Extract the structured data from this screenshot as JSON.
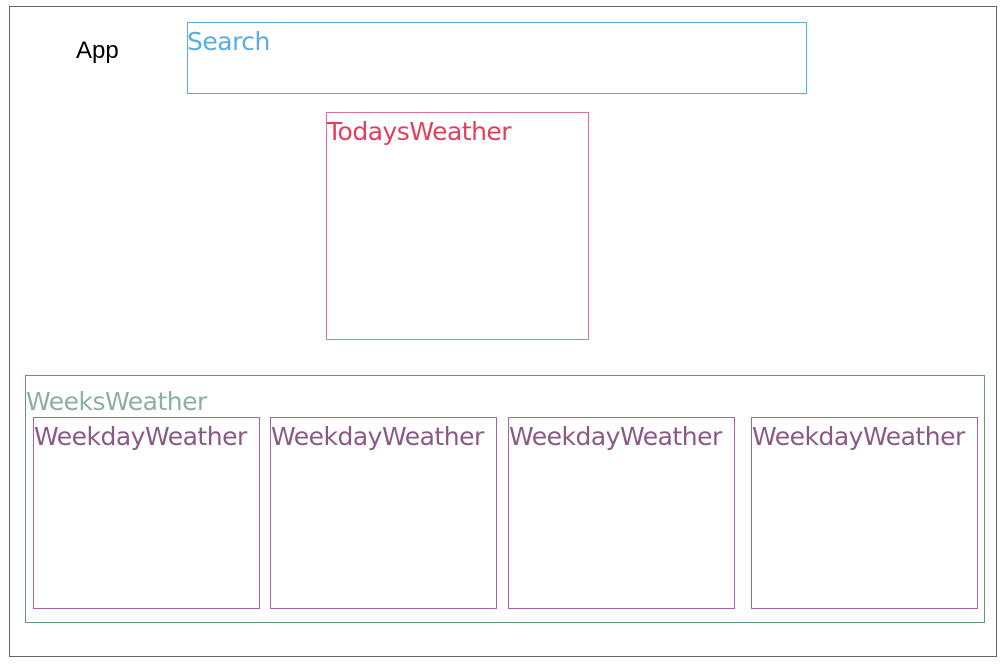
{
  "app": {
    "label": "App",
    "border_color": "#666666"
  },
  "search": {
    "label": "Search",
    "color": "#5aaedc"
  },
  "todays_weather": {
    "label": "TodaysWeather",
    "color": "#e0405a",
    "border_color": "#e0709a"
  },
  "weeks_weather": {
    "label": "WeeksWeather",
    "color": "#8fb0a0",
    "border_color": "#5e9a6e"
  },
  "weekday_weather": {
    "color": "#8a5a86",
    "border_color": "#a264a6",
    "items": [
      {
        "label": "WeekdayWeather"
      },
      {
        "label": "WeekdayWeather"
      },
      {
        "label": "WeekdayWeather"
      },
      {
        "label": "WeekdayWeather"
      }
    ]
  }
}
